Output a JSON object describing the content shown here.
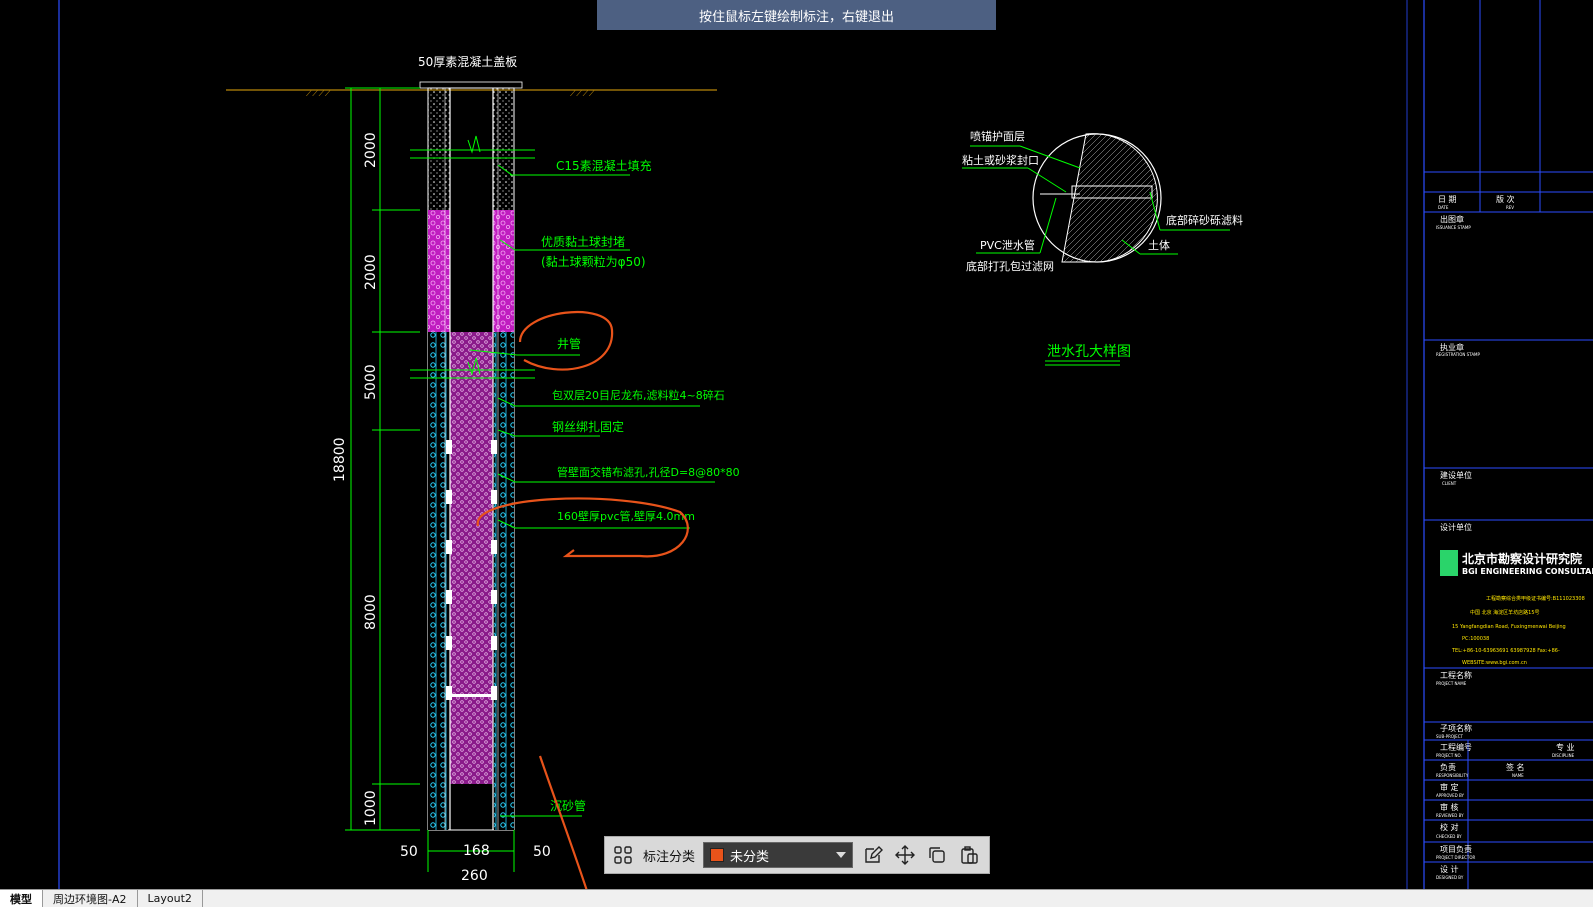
{
  "banner": {
    "text": "按住鼠标左键绘制标注，右键退出"
  },
  "drawing": {
    "top_note": "50厚素混凝土盖板",
    "labels": {
      "c15": "C15素混凝土填充",
      "clay1": "优质黏土球封堵",
      "clay2": "(黏土球颗粒为φ50)",
      "well_pipe": "井管",
      "filter": "包双层20目尼龙布,滤料粒4~8碎石",
      "steel_wire": "钢丝绑扎固定",
      "pipe_hole": "管壁面交错布滤孔,孔径D=8@80*80",
      "pvc_pipe": "160壁厚pvc管,壁厚4.0mm",
      "sand_pipe": "沉砂管"
    },
    "dims_vertical": [
      "2000",
      "2000",
      "5000",
      "8000",
      "1000"
    ],
    "dim_total": "18800",
    "dims_bottom": {
      "left": "50",
      "mid": "168",
      "right": "50",
      "total": "260"
    },
    "detail": {
      "l1": "喷锚护面层",
      "l2": "粘土或砂浆封口",
      "l3": "PVC泄水管",
      "l4": "底部打孔包过滤网",
      "l5": "底部碎砂砾滤料",
      "l6": "土体",
      "title": "泄水孔大样图"
    }
  },
  "title_block": {
    "row1_a": "日 期",
    "row1_a_en": "DATE",
    "row1_b": "版 次",
    "row1_b_en": "REV",
    "seal1": "出图章",
    "seal1_en": "ISSUANCE STAMP",
    "seal2": "执业章",
    "seal2_en": "REGISTRATION STAMP",
    "client": "建设单位",
    "client_en": "CLIENT",
    "designer": "设计单位",
    "company_cn": "北京市勘察设计研究院",
    "company_en": "BGI ENGINEERING CONSULTANTS",
    "cert": "工程勘察综合类甲级证书编号:B111023308",
    "addr_cn": "中国 北京 海淀区羊坊店路15号",
    "addr_en": "15 Yangfangdian Road, Fuxingmenwai Beijing",
    "pc": "PC:100038",
    "tel": "TEL:+86-10-63963691 63987928  Fax:+86-",
    "web": "WEBSITE:www.bgi.com.cn",
    "project": "工程名称",
    "project_en": "PROJECT NAME",
    "subproject": "子项名称",
    "subproject_en": "SUB-PROJECT",
    "project_no": "工程编号",
    "project_no_en": "PROJECT NO.",
    "resp": "负责",
    "resp_en": "RESPONSIBILITY",
    "approve": "审 定",
    "approve_en": "APPROVED BY",
    "review": "审 核",
    "review_en": "REVIEWED BY",
    "check": "校 对",
    "check_en": "CHECKED BY",
    "leader": "项目负责",
    "leader_en": "PROJECT DIRECTOR",
    "design": "设 计",
    "design_en": "DESIGNED BY",
    "sign": "签 名",
    "sign_en": "NAME",
    "draw_no": "专 业",
    "draw_no_en": "DISCIPLINE"
  },
  "toolbar": {
    "category_label": "标注分类",
    "category_value": "未分类",
    "category_color": "#e8531a"
  },
  "tabs": [
    {
      "label": "模型"
    },
    {
      "label": "周边环境图-A2"
    },
    {
      "label": "Layout2"
    }
  ]
}
